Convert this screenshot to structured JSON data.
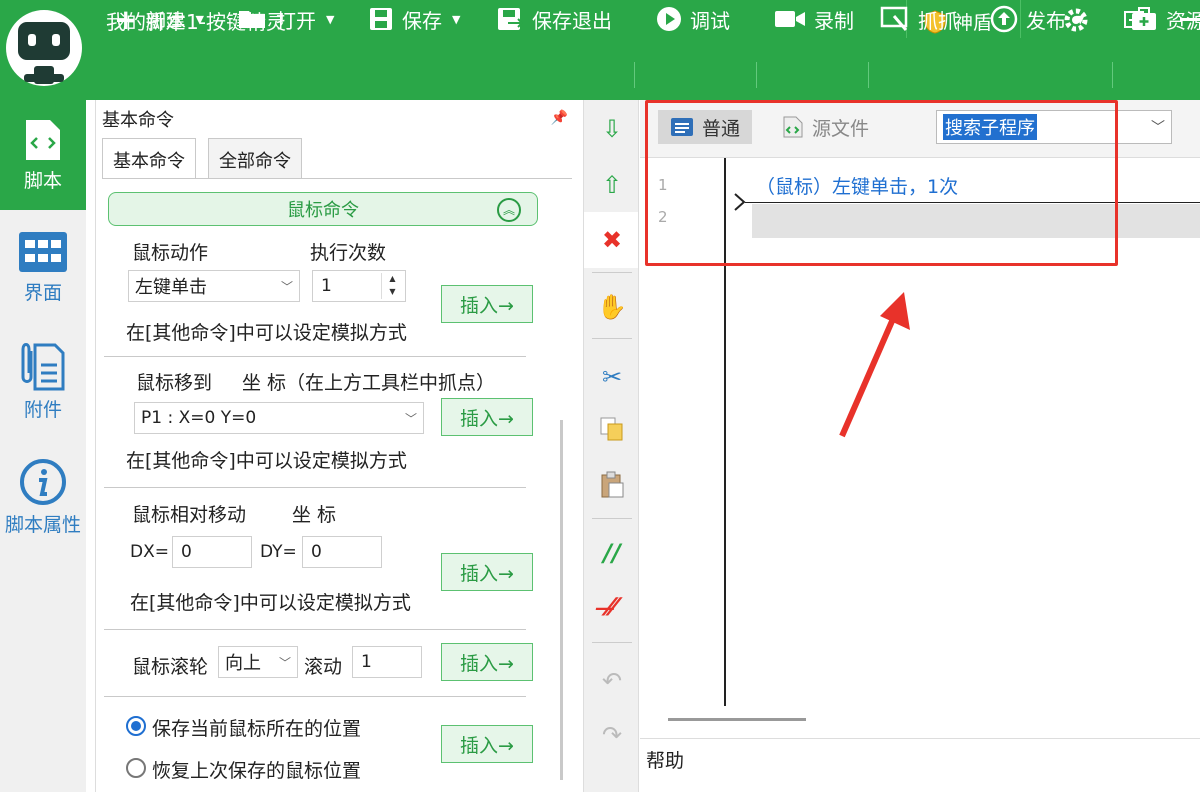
{
  "app": {
    "title": "我的脚本1-按键精灵",
    "shield_label": "神盾"
  },
  "toolbar": {
    "new": "新建",
    "open": "打开",
    "save": "保存",
    "save_exit": "保存退出",
    "debug": "调试",
    "record": "录制",
    "grab": "抓抓",
    "publish": "发布",
    "resources": "资源"
  },
  "nav": {
    "script": "脚本",
    "ui": "界面",
    "attach": "附件",
    "props": "脚本属性"
  },
  "panel": {
    "title": "基本命令",
    "tabs": [
      "基本命令",
      "全部命令"
    ],
    "group_title": "鼠标命令",
    "insert_label": "插入→",
    "hint": "在[其他命令]中可以设定模拟方式",
    "mouse_action": {
      "label": "鼠标动作",
      "count_label": "执行次数",
      "action_value": "左键单击",
      "count_value": "1"
    },
    "move_to": {
      "label": "鼠标移到",
      "coord_label": "坐 标（在上方工具栏中抓点）",
      "value": "P1 : X=0 Y=0"
    },
    "rel_move": {
      "label": "鼠标相对移动",
      "coord_label": "坐 标",
      "dx_label": "DX=",
      "dx": "0",
      "dy_label": "DY=",
      "dy": "0"
    },
    "wheel": {
      "label": "鼠标滚轮",
      "direction": "向上",
      "scroll_label": "滚动",
      "scroll_value": "1"
    },
    "position": {
      "save": "保存当前鼠标所在的位置",
      "restore": "恢复上次保存的鼠标位置"
    }
  },
  "editor": {
    "mode_normal": "普通",
    "mode_source": "源文件",
    "search_value": "搜索子程序",
    "line_numbers": [
      "1",
      "2"
    ],
    "code_line": "（鼠标）左键单击，1次",
    "help": "帮助"
  }
}
